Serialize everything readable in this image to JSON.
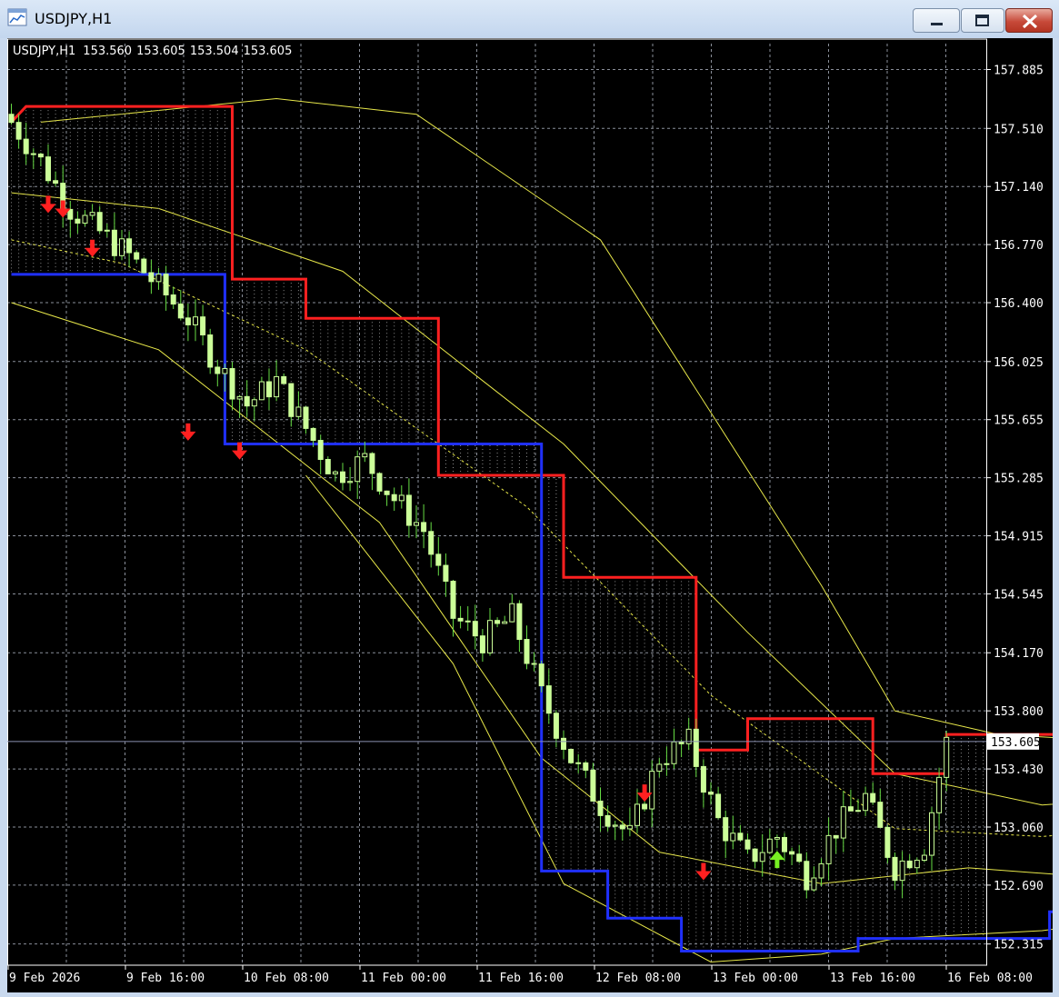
{
  "window": {
    "title": "USDJPY,H1"
  },
  "chart_data": {
    "type": "candlestick",
    "symbol_label": "USDJPY,H1",
    "ohlc_header": {
      "open": "153.560",
      "high": "153.605",
      "low": "153.504",
      "close": "153.605"
    },
    "current_price": "153.605",
    "current_price_value": 153.605,
    "ylim": [
      152.18,
      158.05
    ],
    "y_ticks": [
      "157.885",
      "157.510",
      "157.140",
      "156.770",
      "156.400",
      "156.025",
      "155.655",
      "155.285",
      "154.915",
      "154.545",
      "154.170",
      "153.800",
      "153.430",
      "153.060",
      "152.690",
      "152.315"
    ],
    "x_ticks": [
      "9 Feb 2026",
      "9 Feb 16:00",
      "10 Feb 08:00",
      "11 Feb 00:00",
      "11 Feb 16:00",
      "12 Feb 08:00",
      "13 Feb 00:00",
      "13 Feb 16:00",
      "16 Feb 08:00"
    ],
    "bars": 128,
    "grid": true,
    "colors": {
      "background": "#000000",
      "grid": "#8a8f9a",
      "candle": "#ccff99",
      "wick": "#66dd44",
      "upper_stop": "#ff2020",
      "lower_stop": "#2030ff",
      "band": "#e8e84a",
      "arrow_down": "#ff2020",
      "arrow_up": "#77ee22",
      "axis_text": "#ffffff",
      "price_line": "#8a8fb0"
    },
    "close_anchors": [
      [
        0,
        157.55
      ],
      [
        4,
        157.3
      ],
      [
        8,
        157.0
      ],
      [
        12,
        156.85
      ],
      [
        16,
        156.7
      ],
      [
        20,
        156.5
      ],
      [
        24,
        156.3
      ],
      [
        28,
        156.0
      ],
      [
        32,
        155.75
      ],
      [
        36,
        155.9
      ],
      [
        40,
        155.6
      ],
      [
        44,
        155.3
      ],
      [
        48,
        155.4
      ],
      [
        52,
        155.15
      ],
      [
        56,
        154.95
      ],
      [
        60,
        154.4
      ],
      [
        64,
        154.25
      ],
      [
        68,
        154.4
      ],
      [
        72,
        153.9
      ],
      [
        76,
        153.5
      ],
      [
        80,
        153.2
      ],
      [
        84,
        153.0
      ],
      [
        88,
        153.5
      ],
      [
        92,
        153.6
      ],
      [
        96,
        153.1
      ],
      [
        100,
        152.85
      ],
      [
        104,
        153.0
      ],
      [
        108,
        152.75
      ],
      [
        112,
        153.05
      ],
      [
        116,
        153.25
      ],
      [
        120,
        152.8
      ],
      [
        124,
        152.95
      ],
      [
        127,
        153.6
      ]
    ],
    "upper_stop_steps": [
      [
        0,
        157.55
      ],
      [
        2,
        157.65
      ],
      [
        30,
        157.65
      ],
      [
        30,
        156.55
      ],
      [
        40,
        156.55
      ],
      [
        40,
        156.3
      ],
      [
        58,
        156.3
      ],
      [
        58,
        155.3
      ],
      [
        75,
        155.3
      ],
      [
        75,
        154.65
      ],
      [
        93,
        154.65
      ],
      [
        93,
        153.55
      ],
      [
        100,
        153.55
      ],
      [
        100,
        153.75
      ],
      [
        117,
        153.75
      ],
      [
        117,
        153.4
      ],
      [
        127,
        153.4
      ],
      [
        127,
        153.65
      ],
      [
        155,
        153.65
      ]
    ],
    "lower_stop_steps": [
      [
        0,
        156.58
      ],
      [
        29,
        156.58
      ],
      [
        29,
        155.5
      ],
      [
        72,
        155.5
      ],
      [
        72,
        152.78
      ],
      [
        81,
        152.78
      ],
      [
        81,
        152.48
      ],
      [
        91,
        152.48
      ],
      [
        91,
        152.27
      ],
      [
        115,
        152.27
      ],
      [
        115,
        152.35
      ],
      [
        141,
        152.35
      ],
      [
        141,
        152.52
      ],
      [
        153,
        152.52
      ]
    ],
    "band_upper_outer": [
      [
        4,
        157.55
      ],
      [
        36,
        157.7
      ],
      [
        55,
        157.6
      ],
      [
        80,
        156.8
      ],
      [
        95,
        155.7
      ],
      [
        110,
        154.6
      ],
      [
        120,
        153.8
      ],
      [
        134,
        153.65
      ],
      [
        153,
        153.6
      ]
    ],
    "band_upper_inner": [
      [
        0,
        157.1
      ],
      [
        20,
        157.0
      ],
      [
        45,
        156.6
      ],
      [
        75,
        155.5
      ],
      [
        100,
        154.3
      ],
      [
        120,
        153.4
      ],
      [
        140,
        153.2
      ],
      [
        153,
        153.25
      ]
    ],
    "band_mid": [
      [
        0,
        156.8
      ],
      [
        15,
        156.65
      ],
      [
        40,
        156.1
      ],
      [
        70,
        155.1
      ],
      [
        95,
        153.9
      ],
      [
        120,
        153.05
      ],
      [
        140,
        153.0
      ],
      [
        153,
        153.05
      ]
    ],
    "band_lower_inner": [
      [
        0,
        156.4
      ],
      [
        20,
        156.1
      ],
      [
        50,
        155.0
      ],
      [
        72,
        153.5
      ],
      [
        88,
        152.9
      ],
      [
        110,
        152.7
      ],
      [
        130,
        152.8
      ],
      [
        153,
        152.72
      ]
    ],
    "band_lower_outer": [
      [
        40,
        155.3
      ],
      [
        60,
        154.1
      ],
      [
        75,
        152.7
      ],
      [
        95,
        152.2
      ],
      [
        110,
        152.25
      ],
      [
        120,
        152.35
      ],
      [
        140,
        152.4
      ],
      [
        153,
        152.48
      ]
    ],
    "signals": [
      {
        "bar": 5,
        "price": 157.0,
        "dir": "down"
      },
      {
        "bar": 7,
        "price": 156.97,
        "dir": "down"
      },
      {
        "bar": 11,
        "price": 156.72,
        "dir": "down"
      },
      {
        "bar": 24,
        "price": 155.55,
        "dir": "down"
      },
      {
        "bar": 31,
        "price": 155.43,
        "dir": "down"
      },
      {
        "bar": 86,
        "price": 153.25,
        "dir": "down"
      },
      {
        "bar": 94,
        "price": 152.75,
        "dir": "down"
      },
      {
        "bar": 104,
        "price": 152.88,
        "dir": "up"
      }
    ]
  }
}
